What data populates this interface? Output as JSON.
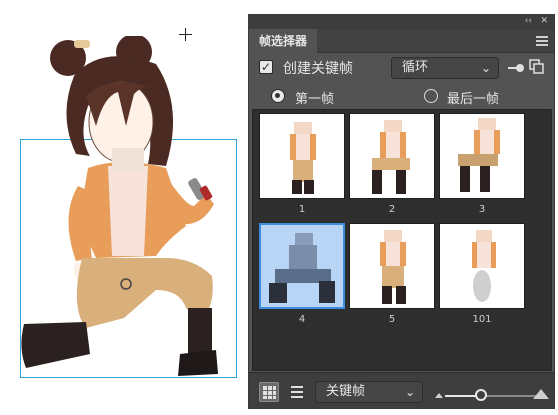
{
  "canvas": {
    "selection_color": "#29a3d6"
  },
  "panel": {
    "title": "帧选择器",
    "collapse_glyph": "‹‹",
    "close_glyph": "✕",
    "menu_icon": "hamburger-menu-icon",
    "create_keyframe": {
      "checked": true,
      "label": "创建关键帧"
    },
    "loop_select": {
      "value": "循环"
    },
    "radio": {
      "first_frame_label": "第一帧",
      "last_frame_label": "最后一帧",
      "selected": "first"
    },
    "frames": [
      {
        "label": "1",
        "selected": false
      },
      {
        "label": "2",
        "selected": false
      },
      {
        "label": "3",
        "selected": false
      },
      {
        "label": "4",
        "selected": true
      },
      {
        "label": "5",
        "selected": false
      },
      {
        "label": "101",
        "selected": false
      }
    ],
    "bottom": {
      "filter_select": {
        "value": "关键帧"
      }
    },
    "colors": {
      "panel_bg": "#535353",
      "grid_bg": "#2e2e2e",
      "selected_border": "#3c8de0",
      "selected_fill": "#b8d5f5"
    }
  }
}
